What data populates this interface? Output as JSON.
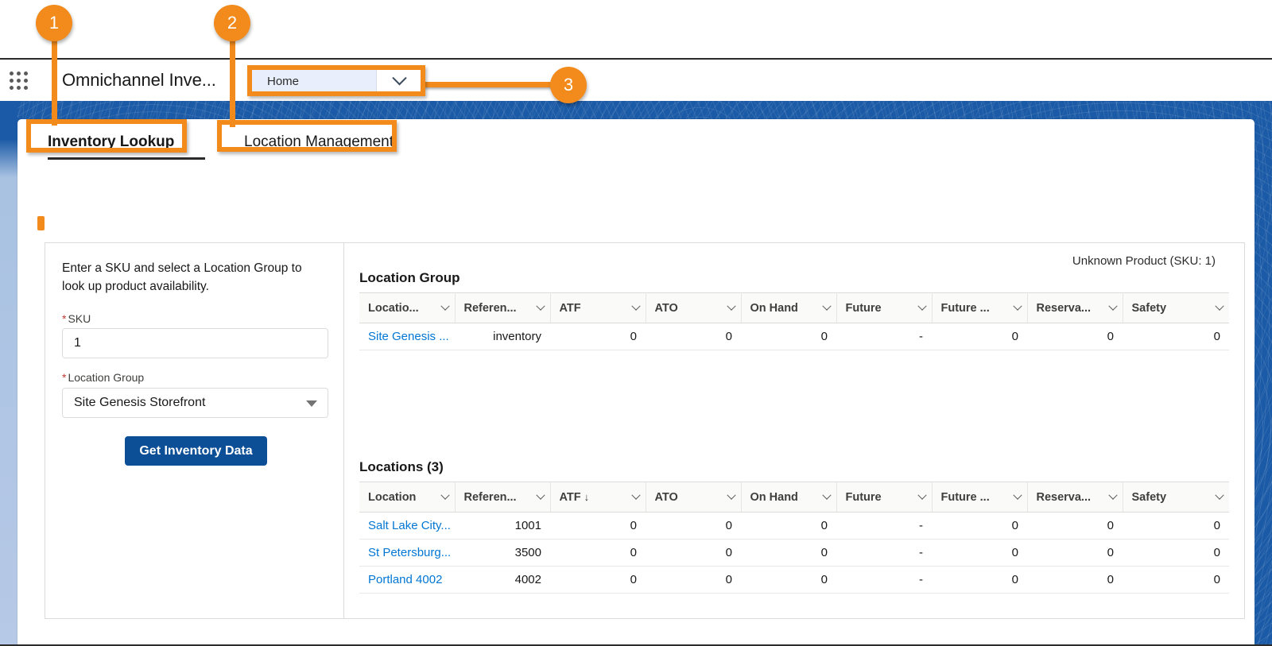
{
  "header": {
    "app_launcher_icon": "app-launcher-grid-icon",
    "app_name": "Omnichannel Inve...",
    "nav_tab_label": "Home",
    "nav_tab_chevron_icon": "chevron-down-icon"
  },
  "subtabs": [
    {
      "label": "Inventory Lookup",
      "active": true
    },
    {
      "label": "Location Management",
      "active": false
    }
  ],
  "form": {
    "description": "Enter a SKU and select a Location Group to look up product availability.",
    "sku_label": "SKU",
    "sku_value": "1",
    "sku_placeholder": "",
    "location_group_label": "Location Group",
    "location_group_value": "Site Genesis Storefront",
    "location_group_caret_icon": "triangle-down-icon",
    "required_marker": "*",
    "submit_label": "Get Inventory Data"
  },
  "results": {
    "product_title": "Unknown Product (SKU: 1)",
    "location_group_section_title": "Location Group",
    "locations_section_title": "Locations (3)",
    "group_table": {
      "columns": [
        "Locatio...",
        "Referen...",
        "ATF",
        "ATO",
        "On Hand",
        "Future",
        "Future ...",
        "Reserva...",
        "Safety"
      ],
      "rows": [
        {
          "location": "Site Genesis ...",
          "reference": "inventory",
          "atf": "0",
          "ato": "0",
          "on_hand": "0",
          "future": "-",
          "future_2": "0",
          "reservation": "0",
          "safety": "0"
        }
      ]
    },
    "locations_table": {
      "columns": [
        "Location",
        "Referen...",
        "ATF",
        "ATO",
        "On Hand",
        "Future",
        "Future ...",
        "Reserva...",
        "Safety"
      ],
      "sorted_column": "ATF",
      "sort_icon": "arrow-down-icon",
      "rows": [
        {
          "location": "Salt Lake City...",
          "reference": "1001",
          "atf": "0",
          "ato": "0",
          "on_hand": "0",
          "future": "-",
          "future_2": "0",
          "reservation": "0",
          "safety": "0"
        },
        {
          "location": "St Petersburg...",
          "reference": "3500",
          "atf": "0",
          "ato": "0",
          "on_hand": "0",
          "future": "-",
          "future_2": "0",
          "reservation": "0",
          "safety": "0"
        },
        {
          "location": "Portland 4002",
          "reference": "4002",
          "atf": "0",
          "ato": "0",
          "on_hand": "0",
          "future": "-",
          "future_2": "0",
          "reservation": "0",
          "safety": "0"
        }
      ]
    }
  },
  "annotations": [
    {
      "number": "1",
      "target": "Inventory Lookup tab"
    },
    {
      "number": "2",
      "target": "Location Management tab"
    },
    {
      "number": "3",
      "target": "Home navigation tab"
    }
  ],
  "colors": {
    "annotation_orange": "#f28b1c",
    "band_blue": "#1b5aa6",
    "primary_button": "#0d4f96",
    "link_blue": "#0176d3",
    "required_red": "#c23934"
  }
}
